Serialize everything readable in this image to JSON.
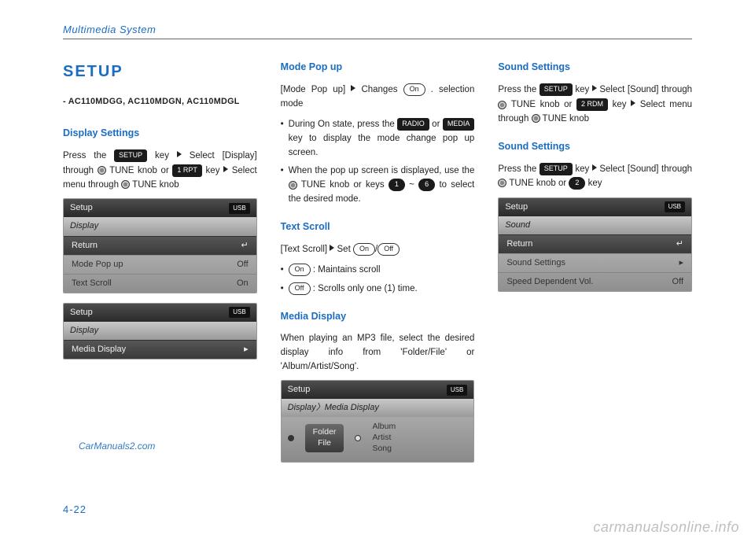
{
  "header": "Multimedia System",
  "title": "SETUP",
  "models": "- AC110MDGG, AC110MDGN, AC110MDGL",
  "col1": {
    "h1": "Display Settings",
    "p1a": "Press the ",
    "keySetup": "SETUP",
    "p1b": " key",
    "p1c": "Select [Display] through ",
    "p1d": " TUNE knob or ",
    "key1rpt": "1 RPT",
    "p1e": " key ",
    "p1f": "Select menu through ",
    "p1g": " TUNE knob",
    "shot1": {
      "top": "Setup",
      "usb": "USB",
      "sub": "Display",
      "rows": [
        {
          "l": "Return",
          "r": "↵",
          "dark": true
        },
        {
          "l": "Mode Pop up",
          "r": "Off"
        },
        {
          "l": "Text Scroll",
          "r": "On"
        }
      ]
    },
    "shot2": {
      "top": "Setup",
      "usb": "USB",
      "sub": "Display",
      "rows": [
        {
          "l": "Media Display",
          "r": "▸",
          "dark": true
        }
      ]
    }
  },
  "col2": {
    "h1": "Mode Pop up",
    "m1a": "[Mode Pop up]",
    "m1b": "Changes ",
    "pillOn": "On",
    "m1c": ". selection mode",
    "b1a": "During On state, press the ",
    "keyRadio": "RADIO",
    "b1b": " or ",
    "keyMedia": "MEDIA",
    "b1c": " key to display the mode change pop up screen.",
    "b2a": "When the pop up screen is displayed, use the ",
    "b2b": " TUNE knob or keys ",
    "key1": "1",
    "b2c": " ~ ",
    "key6": "6",
    "b2d": " to select the desired mode.",
    "h2": "Text Scroll",
    "t1a": "[Text Scroll]",
    "t1b": "Set ",
    "pillOff": "Off",
    "ts_on": " : Maintains scroll",
    "ts_off": " : Scrolls only one (1) time.",
    "h3": "Media Display",
    "md": "When playing an MP3 file, select the desired display info from 'Folder/File' or 'Album/Artist/Song'.",
    "shot": {
      "top": "Setup",
      "usb": "USB",
      "sub": "Display〉Media Display",
      "btn1": "Folder",
      "btn2": "File",
      "l1": "Album",
      "l2": "Artist",
      "l3": "Song"
    }
  },
  "col3": {
    "h1": "Sound Settings",
    "s1a": "Press the ",
    "s1b": " key",
    "s1c": "Select [Sound] through ",
    "s1d": " TUNE knob or ",
    "key2rdm": "2 RDM",
    "s1e": " key ",
    "s1f": "Select menu through ",
    "s1g": " TUNE knob",
    "h2": "Sound Settings",
    "s2a": "Press the ",
    "s2b": " key",
    "s2c": "Select [Sound] through ",
    "s2d": " TUNE knob or ",
    "key2": "2",
    "s2e": " key",
    "shot": {
      "top": "Setup",
      "usb": "USB",
      "sub": "Sound",
      "rows": [
        {
          "l": "Return",
          "r": "↵",
          "dark": true
        },
        {
          "l": "Sound Settings",
          "r": "▸"
        },
        {
          "l": "Speed Dependent Vol.",
          "r": "Off"
        }
      ]
    }
  },
  "watermark1": "CarManuals2.com",
  "pageNum": "4-22",
  "watermark2": "carmanualsonline.info"
}
